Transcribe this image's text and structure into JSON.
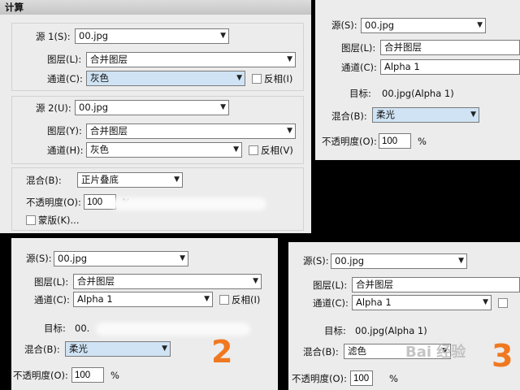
{
  "panel1": {
    "title": "计算",
    "src1": {
      "label": "源 1(S):",
      "value": "00.jpg"
    },
    "layer1": {
      "label": "图层(L):",
      "value": "合并图层"
    },
    "channel1": {
      "label": "通道(C):",
      "value": "灰色",
      "invert": "反相(I)"
    },
    "src2": {
      "label": "源 2(U):",
      "value": "00.jpg"
    },
    "layer2": {
      "label": "图层(Y):",
      "value": "合并图层"
    },
    "channel2": {
      "label": "通道(H):",
      "value": "灰色",
      "invert": "反相(V)"
    },
    "blend": {
      "label": "混合(B):",
      "value": "正片叠底"
    },
    "opacity": {
      "label": "不透明度(O):",
      "value": "100",
      "unit": "%"
    },
    "mask": "蒙版(K)..."
  },
  "panel2": {
    "src": {
      "label": "源(S):",
      "value": "00.jpg"
    },
    "layer": {
      "label": "图层(L):",
      "value": "合并图层"
    },
    "channel": {
      "label": "通道(C):",
      "value": "Alpha 1"
    },
    "target": {
      "label": "目标:",
      "value": "00.jpg(Alpha 1)"
    },
    "blend": {
      "label": "混合(B):",
      "value": "柔光"
    },
    "opacity": {
      "label": "不透明度(O):",
      "value": "100",
      "unit": "%"
    }
  },
  "panel3": {
    "src": {
      "label": "源(S):",
      "value": "00.jpg"
    },
    "layer": {
      "label": "图层(L):",
      "value": "合并图层"
    },
    "channel": {
      "label": "通道(C):",
      "value": "Alpha 1",
      "invert": "反相(I)"
    },
    "target": {
      "label": "目标:",
      "value": "00."
    },
    "blend": {
      "label": "混合(B):",
      "value": "柔光"
    },
    "opacity": {
      "label": "不透明度(O):",
      "value": "100",
      "unit": "%"
    },
    "annotation": "2"
  },
  "panel4": {
    "src": {
      "label": "源(S):",
      "value": "00.jpg"
    },
    "layer": {
      "label": "图层(L):",
      "value": "合并图层"
    },
    "channel": {
      "label": "通道(C):",
      "value": "Alpha 1"
    },
    "target": {
      "label": "目标:",
      "value": "00.jpg(Alpha 1)"
    },
    "blend": {
      "label": "混合(B):",
      "value": "滤色"
    },
    "opacity": {
      "label": "不透明度(O):",
      "value": "100",
      "unit": "%"
    },
    "annotation": "3",
    "watermark": "Bai 经验"
  }
}
